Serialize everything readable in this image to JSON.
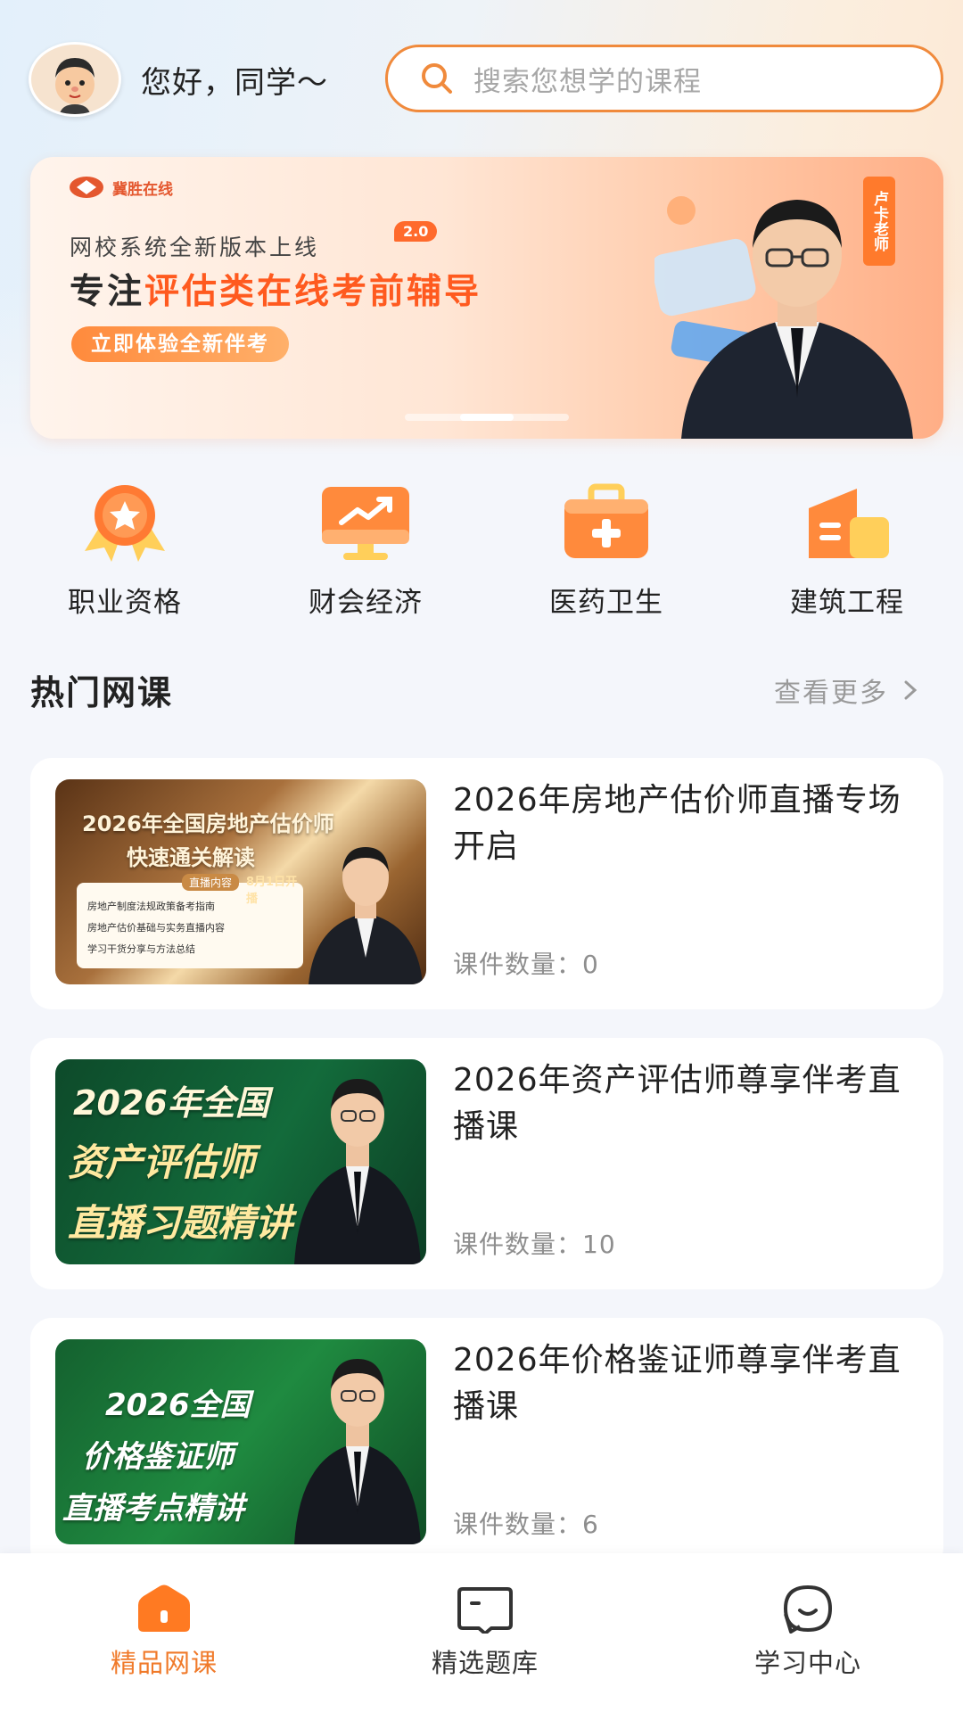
{
  "header": {
    "greeting": "您好，同学～",
    "search_placeholder": "搜索您想学的课程"
  },
  "banner": {
    "logo_text": "冀胜在线",
    "line1": "网校系统全新版本上线",
    "version_badge": "2.0",
    "line2_prefix": "专注",
    "line2_highlight": "评估类在线考前辅导",
    "cta": "立即体验全新伴考",
    "teacher_tag": "卢卡老师",
    "slide_count": 3,
    "active_slide": 2
  },
  "categories": [
    {
      "label": "职业资格",
      "icon": "medal-icon"
    },
    {
      "label": "财会经济",
      "icon": "chart-monitor-icon"
    },
    {
      "label": "医药卫生",
      "icon": "medical-kit-icon"
    },
    {
      "label": "建筑工程",
      "icon": "building-icon"
    }
  ],
  "hot_courses": {
    "title": "热门网课",
    "more": "查看更多",
    "items": [
      {
        "title": "2026年房地产估价师直播专场开启",
        "count": "课件数量：0",
        "thumb_line1": "2026年全国房地产估价师",
        "thumb_line2": "快速通关解读",
        "thumb_tag": "直播内容",
        "thumb_date": "8月1日开播",
        "thumb_points": [
          "房地产制度法规政策备考指南",
          "房地产估价基础与实务直播内容",
          "学习干货分享与方法总结"
        ]
      },
      {
        "title": "2026年资产评估师尊享伴考直播课",
        "count": "课件数量：10",
        "thumb_line1": "2026年全国",
        "thumb_line2": "资产评估师",
        "thumb_line3": "直播习题精讲"
      },
      {
        "title": "2026年价格鉴证师尊享伴考直播课",
        "count": "课件数量：6",
        "thumb_line1": "2026全国",
        "thumb_line2": "价格鉴证师",
        "thumb_line3": "直播考点精讲"
      }
    ]
  },
  "tabbar": [
    {
      "label": "精品网课",
      "icon": "home-icon",
      "active": true
    },
    {
      "label": "精选题库",
      "icon": "question-bank-icon",
      "active": false
    },
    {
      "label": "学习中心",
      "icon": "study-center-icon",
      "active": false
    }
  ],
  "colors": {
    "accent": "#f08a3c",
    "tab_active": "#f07a2a",
    "tab_inactive": "#333333"
  }
}
